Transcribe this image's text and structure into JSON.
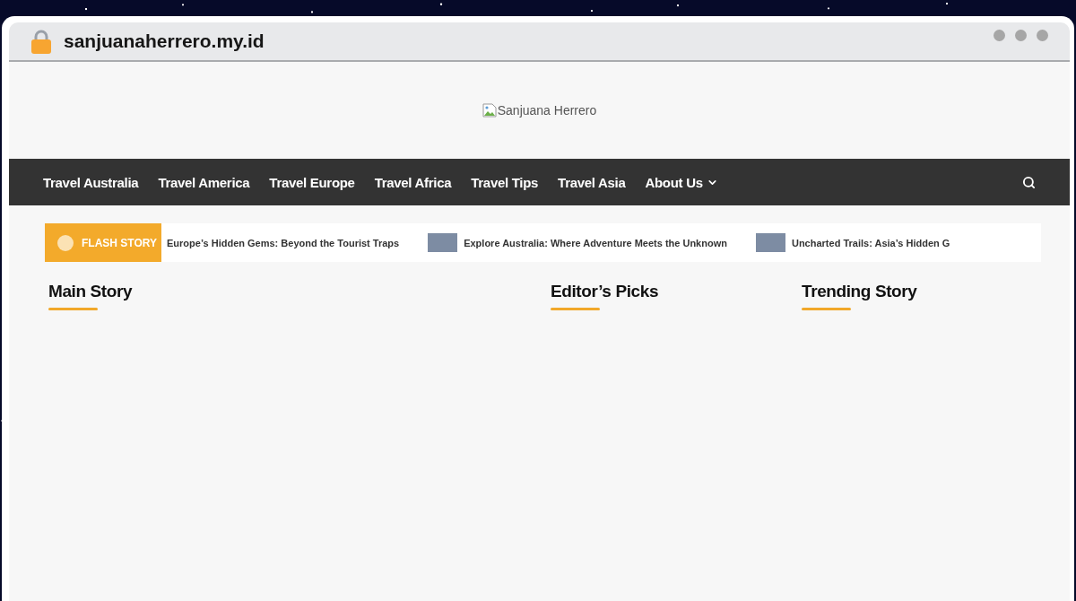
{
  "browser": {
    "url": "sanjuanaherrero.my.id"
  },
  "header": {
    "logo_alt": "Sanjuana Herrero"
  },
  "nav": {
    "items": [
      {
        "label": "Travel Australia",
        "has_submenu": false
      },
      {
        "label": "Travel America",
        "has_submenu": false
      },
      {
        "label": "Travel Europe",
        "has_submenu": false
      },
      {
        "label": "Travel Africa",
        "has_submenu": false
      },
      {
        "label": "Travel Tips",
        "has_submenu": false
      },
      {
        "label": "Travel Asia",
        "has_submenu": false
      },
      {
        "label": "About Us",
        "has_submenu": true
      }
    ]
  },
  "flash_story": {
    "label": "FLASH STORY",
    "items": [
      {
        "title": "Europe’s Hidden Gems: Beyond the Tourist Traps",
        "has_thumbnail": false
      },
      {
        "title": "Explore Australia: Where Adventure Meets the Unknown",
        "has_thumbnail": true
      },
      {
        "title": "Uncharted Trails: Asia’s Hidden G",
        "has_thumbnail": true
      }
    ]
  },
  "sections": [
    {
      "title": "Main Story"
    },
    {
      "title": "Editor’s Picks"
    },
    {
      "title": "Trending Story"
    }
  ]
}
